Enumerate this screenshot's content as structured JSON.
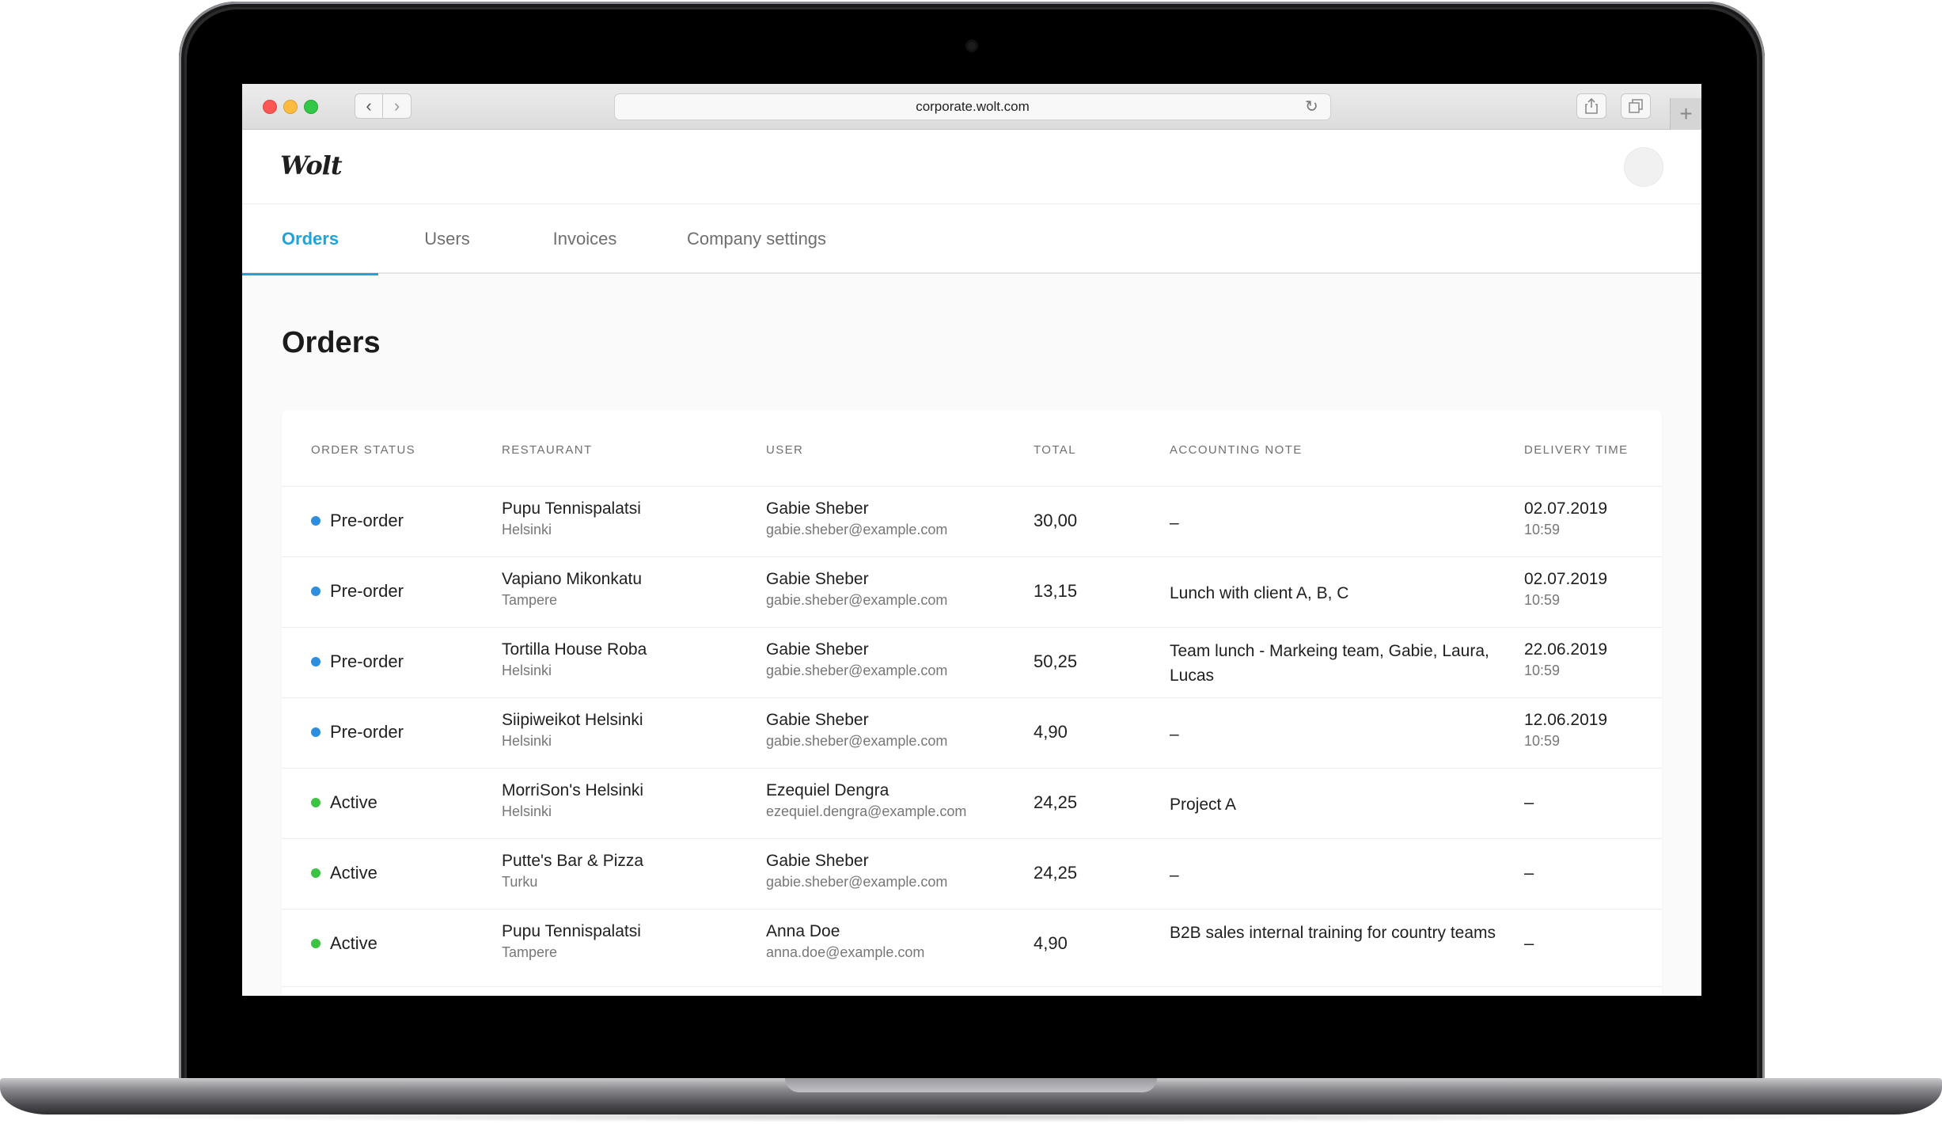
{
  "browser": {
    "url": "corporate.wolt.com"
  },
  "app": {
    "logo": "Wolt"
  },
  "tabs": [
    {
      "label": "Orders",
      "active": true
    },
    {
      "label": "Users",
      "active": false
    },
    {
      "label": "Invoices",
      "active": false
    },
    {
      "label": "Company settings",
      "active": false
    }
  ],
  "page": {
    "title": "Orders"
  },
  "table": {
    "headers": [
      "Order Status",
      "Restaurant",
      "User",
      "Total",
      "Accounting Note",
      "Delivery Time"
    ],
    "rows": [
      {
        "status": "Pre-order",
        "status_color": "#2d8ee0",
        "restaurant": "Pupu Tennispalatsi",
        "city": "Helsinki",
        "user": "Gabie Sheber",
        "email": "gabie.sheber@example.com",
        "total": "30,00",
        "note": "–",
        "date": "02.07.2019",
        "time": "10:59"
      },
      {
        "status": "Pre-order",
        "status_color": "#2d8ee0",
        "restaurant": "Vapiano Mikonkatu",
        "city": "Tampere",
        "user": "Gabie Sheber",
        "email": "gabie.sheber@example.com",
        "total": "13,15",
        "note": "Lunch with client A, B, C",
        "date": "02.07.2019",
        "time": "10:59"
      },
      {
        "status": "Pre-order",
        "status_color": "#2d8ee0",
        "restaurant": "Tortilla House Roba",
        "city": "Helsinki",
        "user": "Gabie Sheber",
        "email": "gabie.sheber@example.com",
        "total": "50,25",
        "note": "Team lunch - Markeing team, Gabie, Laura, Lucas",
        "date": "22.06.2019",
        "time": "10:59"
      },
      {
        "status": "Pre-order",
        "status_color": "#2d8ee0",
        "restaurant": "Siipiweikot Helsinki",
        "city": "Helsinki",
        "user": "Gabie Sheber",
        "email": "gabie.sheber@example.com",
        "total": "4,90",
        "note": "–",
        "date": "12.06.2019",
        "time": "10:59"
      },
      {
        "status": "Active",
        "status_color": "#3cc341",
        "restaurant": "MorriSon's Helsinki",
        "city": "Helsinki",
        "user": "Ezequiel Dengra",
        "email": "ezequiel.dengra@example.com",
        "total": "24,25",
        "note": "Project A",
        "date": "–",
        "time": ""
      },
      {
        "status": "Active",
        "status_color": "#3cc341",
        "restaurant": "Putte's Bar & Pizza",
        "city": "Turku",
        "user": "Gabie Sheber",
        "email": "gabie.sheber@example.com",
        "total": "24,25",
        "note": "–",
        "date": "–",
        "time": ""
      },
      {
        "status": "Active",
        "status_color": "#3cc341",
        "restaurant": "Pupu Tennispalatsi",
        "city": "Tampere",
        "user": "Anna Doe",
        "email": "anna.doe@example.com",
        "total": "4,90",
        "note": "B2B sales internal training for country teams",
        "date": "–",
        "time": ""
      }
    ]
  },
  "colors": {
    "accent": "#1fa3d9",
    "preorder": "#2d8ee0",
    "active": "#3cc341"
  }
}
